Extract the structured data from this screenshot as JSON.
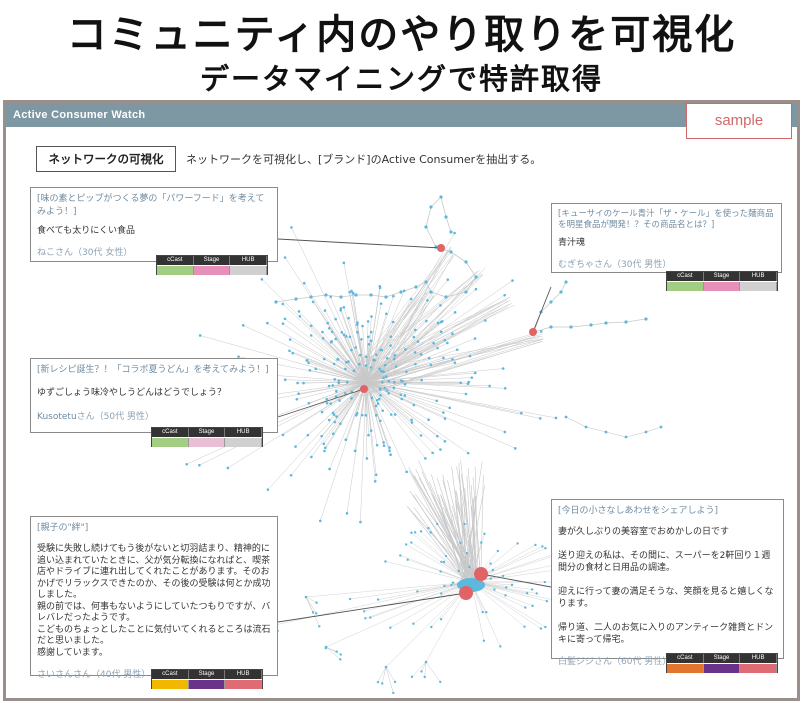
{
  "page": {
    "title": "コミュニティ内のやり取りを可視化",
    "subtitle": "データマイニングで特許取得"
  },
  "app": {
    "name": "Active Consumer Watch",
    "sample_label": "sample",
    "viz_button": "ネットワークの可視化",
    "viz_description": "ネットワークを可視化し、[ブランド]のActive Consumerを抽出する。"
  },
  "meter_labels": {
    "ccast": "cCast",
    "stage": "Stage",
    "hub": "HUB"
  },
  "colors": {
    "node": "#5cb8dc",
    "edge": "#c8c8c8",
    "highlight": "#e06466"
  },
  "callouts": [
    {
      "topic": "[味の素とピップがつくる夢の「パワーフード」を考えてみよう！]",
      "body": "食べても太りにくい食品",
      "user": "ねこさん（30代 女性）",
      "meter": [
        "#a4cd84",
        "#e68fb9",
        "#d0d0d0"
      ]
    },
    {
      "topic": "[キューサイのケール青汁「ザ・ケール」を使った麺商品を明星食品が開発！？その商品名とは？]",
      "body": "青汁魂",
      "user": "むぎちゃさん（30代 男性）",
      "meter": [
        "#a4cd84",
        "#e68fb9",
        "#d0d0d0"
      ]
    },
    {
      "topic": "[新レシピ誕生？！「コラボ夏うどん」を考えてみよう！]",
      "body": "ゆずごしょう味冷やしうどんはどうでしょう？",
      "user_name": "Kusotetu",
      "user_suffix": "さん（50代 男性）",
      "meter": [
        "#a4cd84",
        "#e8bfd5",
        "#d0d0d0"
      ]
    },
    {
      "topic": "[親子の\"絆\"]",
      "body": "受験に失敗し続けてもう後がないと切羽詰まり、精神的に追い込まれていたときに、父が気分転換になればと、喫茶店やドライブに連れ出してくれたことがあります。そのおかげでリラックスできたのか、その後の受験は何とか成功しました。\n親の前では、何事もないようにしていたつもりですが、バレバレだったようです。\nこどものちょっとしたことに気付いてくれるところは流石だと思いました。\n感謝しています。",
      "user": "さいさんさん（40代 男性）",
      "meter": [
        "#f2b800",
        "#6a3288",
        "#df6b74"
      ]
    },
    {
      "topic": "[今日の小さなしあわせをシェアしよう]",
      "body": "妻が久しぶりの美容室でおめかしの日です\n\n送り迎えの私は、その間に、スーパーを2軒回り１週間分の食材と日用品の調達。\n\n迎えに行って妻の満足そうな、笑顔を見ると嬉しくなります。\n\n帰り道、二人のお気に入りのアンティーク雑貨とドンキに寄って帰宅。",
      "user": "白髪ジジさん（60代 男性）",
      "meter": [
        "#e0762f",
        "#6a3288",
        "#df6b74"
      ]
    }
  ]
}
